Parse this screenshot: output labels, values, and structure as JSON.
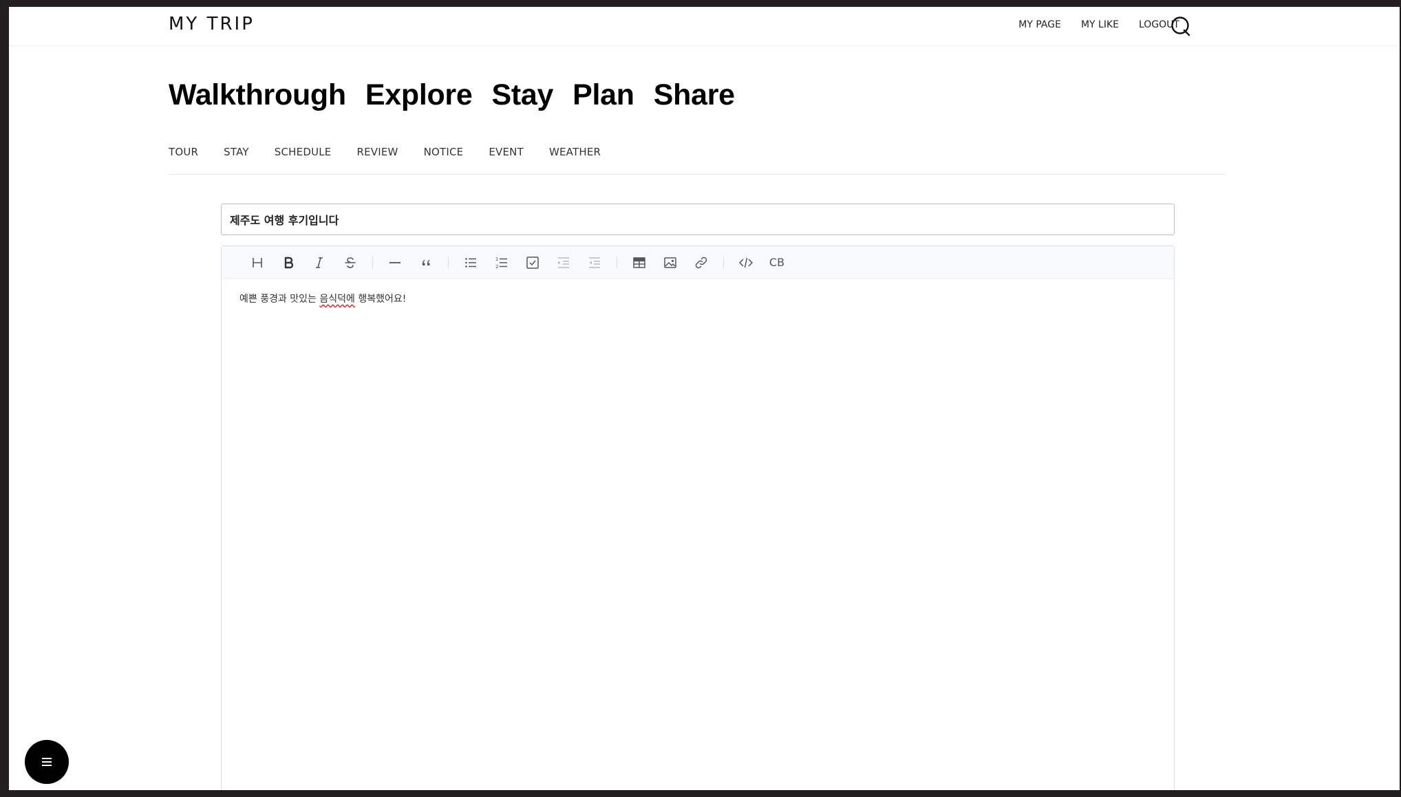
{
  "header": {
    "logo": "MY TRIP",
    "links": [
      "MY PAGE",
      "MY LIKE",
      "LOGOUT"
    ]
  },
  "hero": [
    "Walkthrough",
    "Explore",
    "Stay",
    "Plan",
    "Share"
  ],
  "submenu": [
    "TOUR",
    "STAY",
    "SCHEDULE",
    "REVIEW",
    "NOTICE",
    "EVENT",
    "WEATHER"
  ],
  "editor": {
    "title_value": "제주도 여행 후기입니다",
    "content_before": "예쁜 풍경과 맛있는 ",
    "content_misspelled": "음식덕에",
    "content_after": " 행복했어요!",
    "codeblock_label": "CB"
  }
}
